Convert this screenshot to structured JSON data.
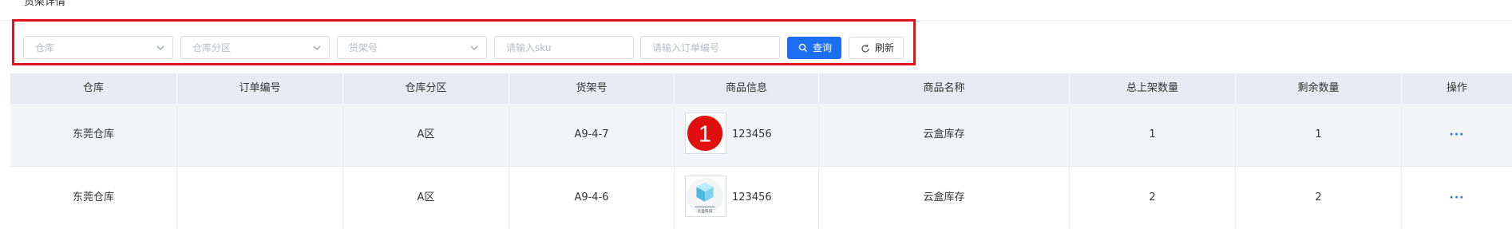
{
  "page": {
    "title": "货架详情"
  },
  "filters": {
    "warehouse_placeholder": "仓库",
    "zone_placeholder": "仓库分区",
    "shelf_placeholder": "货架号",
    "sku_placeholder": "请输入sku",
    "order_placeholder": "请输入订单编号",
    "query_label": "查询",
    "refresh_label": "刷新"
  },
  "table": {
    "columns": [
      "仓库",
      "订单编号",
      "仓库分区",
      "货架号",
      "商品信息",
      "商品名称",
      "总上架数量",
      "剩余数量",
      "操作"
    ],
    "rows": [
      {
        "warehouse": "东莞仓库",
        "order_no": "",
        "zone": "A区",
        "shelf": "A9-4-7",
        "sku": "123456",
        "thumb_label": "1",
        "name": "云盒库存",
        "total_qty": "1",
        "remaining_qty": "1",
        "ops": "···"
      },
      {
        "warehouse": "东莞仓库",
        "order_no": "",
        "zone": "A区",
        "shelf": "A9-4-6",
        "sku": "123456",
        "thumb_label": "云盒科技",
        "name": "云盒库存",
        "total_qty": "2",
        "remaining_qty": "2",
        "ops": "···"
      }
    ]
  },
  "colors": {
    "primary": "#1d6ff2",
    "highlight": "#e0141e",
    "header_bg": "#e7eaf0"
  }
}
